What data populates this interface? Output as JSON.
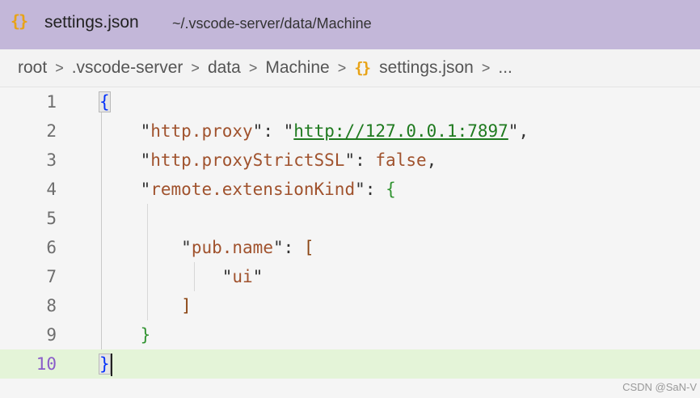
{
  "tab": {
    "icon": "{}",
    "title": "settings.json",
    "description": "~/.vscode-server/data/Machine"
  },
  "breadcrumb": {
    "items": [
      "root",
      ".vscode-server",
      "data",
      "Machine"
    ],
    "file_icon": "{}",
    "file": "settings.json",
    "separator": ">",
    "more": "..."
  },
  "editor": {
    "current_line": 10,
    "lines": [
      {
        "num": "1"
      },
      {
        "num": "2",
        "key": "http.proxy",
        "value": "http://127.0.0.1:7897"
      },
      {
        "num": "3",
        "key": "http.proxyStrictSSL",
        "value": "false"
      },
      {
        "num": "4",
        "key": "remote.extensionKind"
      },
      {
        "num": "5"
      },
      {
        "num": "6",
        "key": "pub.name"
      },
      {
        "num": "7",
        "value": "ui"
      },
      {
        "num": "8"
      },
      {
        "num": "9"
      },
      {
        "num": "10"
      }
    ]
  },
  "watermark": "CSDN @SaN-V",
  "colors": {
    "tab_bar": "#c3b7d9",
    "json_icon": "#e8a317",
    "current_line": "#e4f4d8",
    "brace_outer": "#0431fa",
    "brace_inner": "#319331",
    "bracket": "#8b4513",
    "string": "#a0522d",
    "link": "#1f7a1f"
  }
}
